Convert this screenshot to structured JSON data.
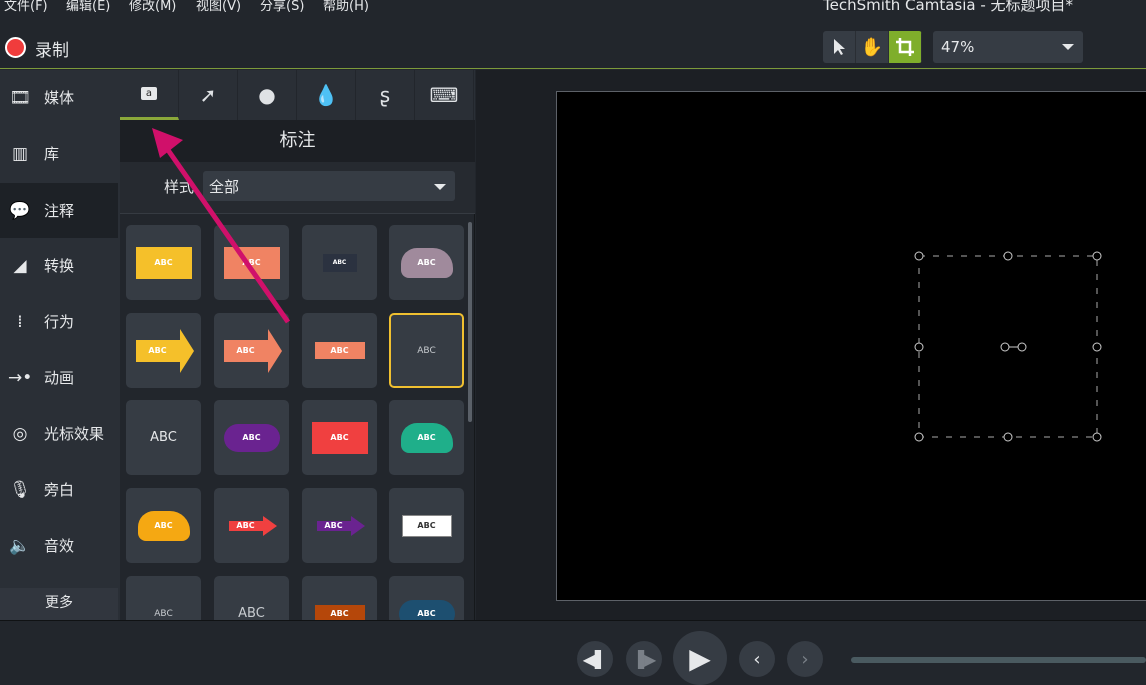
{
  "app": {
    "title": "TechSmith Camtasia - 无标题项目*"
  },
  "menu": [
    "文件(F)",
    "编辑(E)",
    "修改(M)",
    "视图(V)",
    "分享(S)",
    "帮助(H)"
  ],
  "toolbar": {
    "record_label": "录制",
    "zoom": "47%",
    "tools": [
      "select-arrow-icon",
      "hand-pan-icon",
      "crop-icon"
    ],
    "active_tool": "crop-icon",
    "accent": "#7fae2b"
  },
  "sidebar": {
    "items": [
      {
        "label": "媒体",
        "icon": "film-icon"
      },
      {
        "label": "库",
        "icon": "library-icon"
      },
      {
        "label": "注释",
        "icon": "annotation-icon",
        "selected": true
      },
      {
        "label": "转换",
        "icon": "transition-icon"
      },
      {
        "label": "行为",
        "icon": "behavior-icon"
      },
      {
        "label": "动画",
        "icon": "animation-icon"
      },
      {
        "label": "光标效果",
        "icon": "cursor-effect-icon"
      },
      {
        "label": "旁白",
        "icon": "microphone-icon"
      },
      {
        "label": "音效",
        "icon": "speaker-icon"
      }
    ],
    "more": "更多"
  },
  "panel": {
    "tabs": [
      "callout-icon",
      "arrow-icon",
      "shape-icon",
      "blur-icon",
      "sketch-icon",
      "keystroke-icon"
    ],
    "title": "标注",
    "filter_label": "样式",
    "filter_value": "全部",
    "tiles": [
      {
        "text": "ABC",
        "kind": "callout",
        "color": "#f5c02a"
      },
      {
        "text": "ABC",
        "kind": "callout",
        "color": "#f08363"
      },
      {
        "text": "ABC",
        "kind": "thought-box",
        "color": "#2b3240"
      },
      {
        "text": "ABC",
        "kind": "cloud",
        "color": "#a08a9c"
      },
      {
        "text": "ABC",
        "kind": "arrow",
        "color": "#f5c02a"
      },
      {
        "text": "ABC",
        "kind": "arrow",
        "color": "#f08363"
      },
      {
        "text": "ABC",
        "kind": "banner",
        "color": "#f08363"
      },
      {
        "text": "ABC",
        "kind": "text",
        "color": "#c8ccd0",
        "selected": true
      },
      {
        "text": "ABC",
        "kind": "text-large",
        "color": "#e6e8ea"
      },
      {
        "text": "ABC",
        "kind": "speech-oval",
        "color": "#6a2390"
      },
      {
        "text": "ABC",
        "kind": "callout",
        "color": "#f04040"
      },
      {
        "text": "ABC",
        "kind": "cloud",
        "color": "#1faf8a"
      },
      {
        "text": "ABC",
        "kind": "cloud",
        "color": "#f5a812"
      },
      {
        "text": "ABC",
        "kind": "arrow-thin",
        "color": "#f04040"
      },
      {
        "text": "ABC",
        "kind": "arrow-thin",
        "color": "#6a2390"
      },
      {
        "text": "ABC",
        "kind": "box-white",
        "color": "#ffffff"
      },
      {
        "text": "ABC",
        "kind": "text",
        "color": "#c8ccd0"
      },
      {
        "text": "ABC",
        "kind": "text-large",
        "color": "#c8ccd0"
      },
      {
        "text": "ABC",
        "kind": "banner",
        "color": "#b5470a"
      },
      {
        "text": "ABC",
        "kind": "oval",
        "color": "#1d4f70"
      }
    ]
  },
  "annotation_arrow_color": "#d0106a",
  "playback": {
    "buttons": [
      "step-back-icon",
      "step-forward-icon",
      "play-icon",
      "previous-icon",
      "next-icon"
    ]
  }
}
